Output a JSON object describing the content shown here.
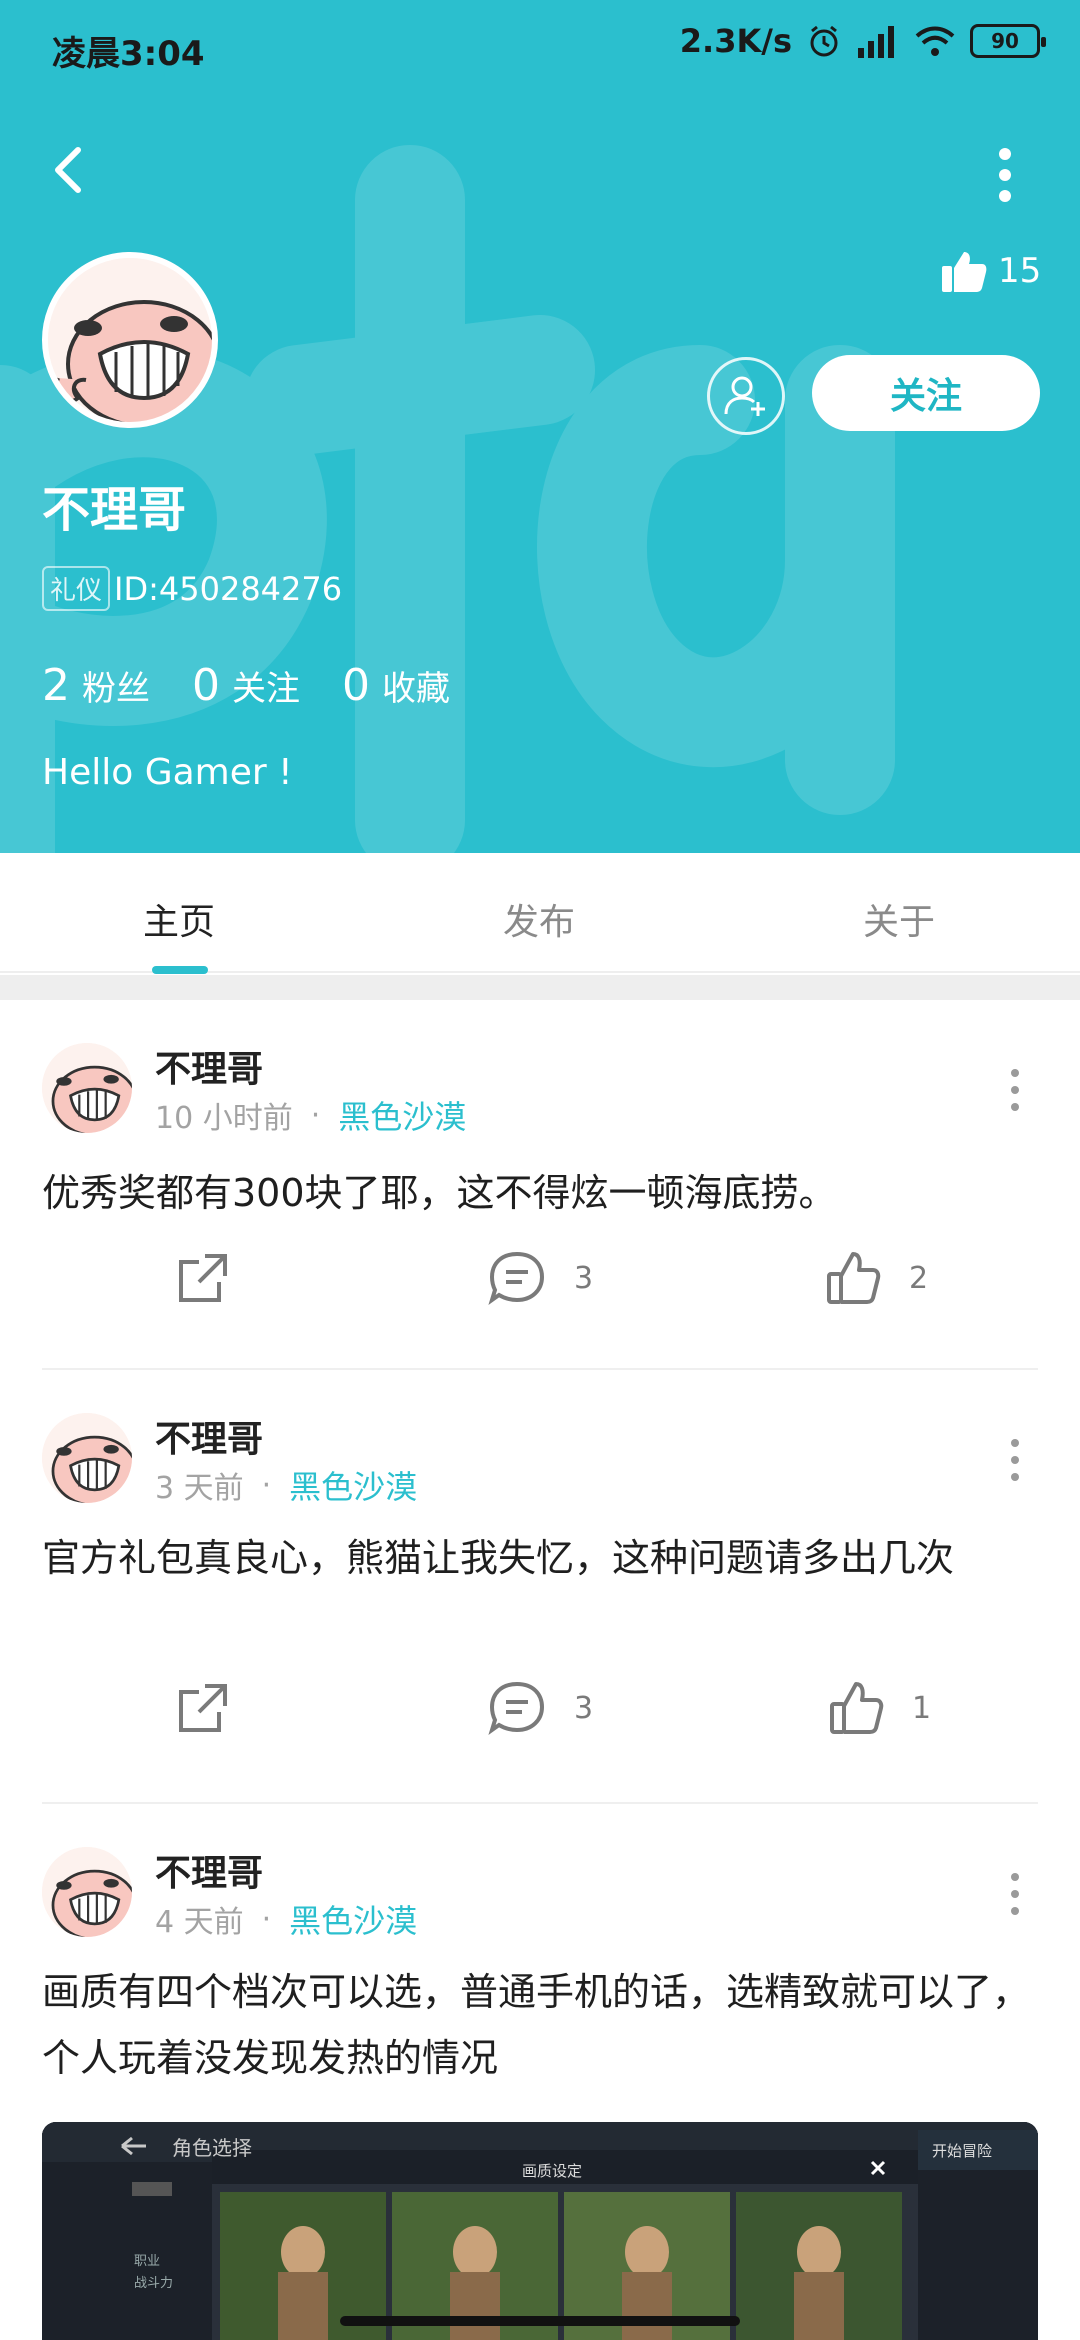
{
  "status": {
    "time": "凌晨3:04",
    "speed": "2.3K/s",
    "battery": "90"
  },
  "profile": {
    "likes": "15",
    "name": "不理哥",
    "badge": "礼仪",
    "id": "ID:450284276",
    "follow_label": "关注",
    "stats": [
      {
        "num": "2",
        "label": "粉丝"
      },
      {
        "num": "0",
        "label": "关注"
      },
      {
        "num": "0",
        "label": "收藏"
      }
    ],
    "bio": "Hello Gamer !"
  },
  "tabs": [
    {
      "label": "主页"
    },
    {
      "label": "发布"
    },
    {
      "label": "关于"
    }
  ],
  "posts": [
    {
      "author": "不理哥",
      "time": "10 小时前",
      "tag": "黑色沙漠",
      "text": "优秀奖都有300块了耶，这不得炫一顿海底捞。",
      "comments": "3",
      "likes": "2"
    },
    {
      "author": "不理哥",
      "time": "3 天前",
      "tag": "黑色沙漠",
      "text": "官方礼包真良心，熊猫让我失忆，这种问题请多出几次",
      "comments": "3",
      "likes": "1"
    },
    {
      "author": "不理哥",
      "time": "4 天前",
      "tag": "黑色沙漠",
      "text": "画质有四个档次可以选，普通手机的话，选精致就可以了，个人玩着没发现发热的情况"
    }
  ],
  "game_screenshot": {
    "title": "角色选择",
    "dialog_title": "画质设定",
    "start_label": "开始冒险",
    "side_labels": [
      "职业",
      "战斗力"
    ]
  },
  "colors": {
    "accent": "#2bbfce",
    "header_bg": "#2bbfce"
  }
}
